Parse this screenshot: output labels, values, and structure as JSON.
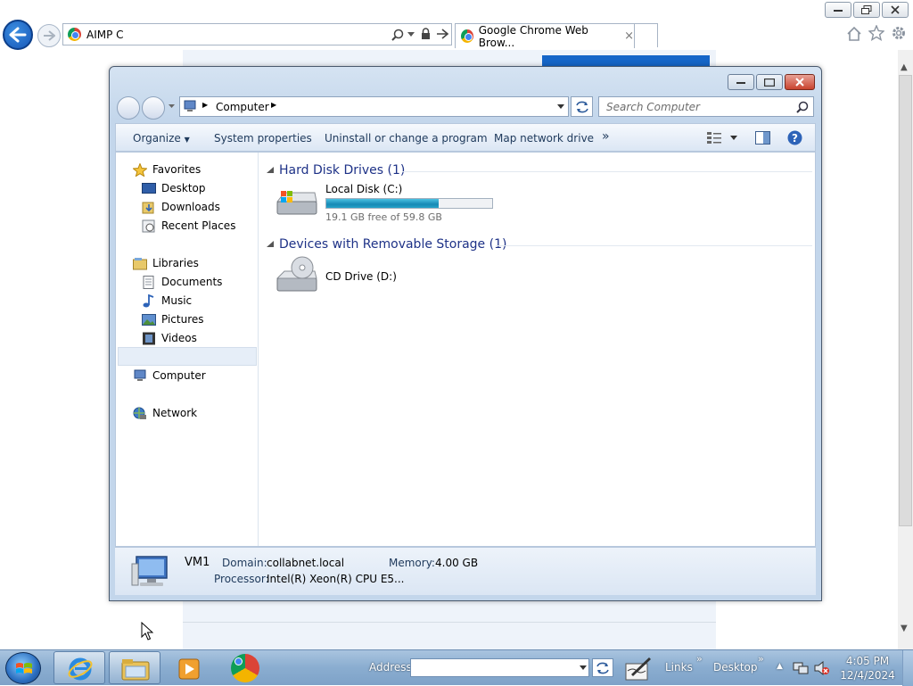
{
  "browser": {
    "address_text": "AIMP C",
    "tab_title": "Google Chrome Web Brow...",
    "tab_close_glyph": "×",
    "caption": {
      "minimize": "▭",
      "restore": "⧉",
      "close": "✕"
    },
    "icons": [
      "back-arrow-icon",
      "forward-arrow-icon",
      "search-icon",
      "lock-icon",
      "refresh-icon",
      "home-icon",
      "favorites-star-icon",
      "settings-gear-icon"
    ]
  },
  "explorer": {
    "breadcrumb": [
      "Computer"
    ],
    "search_placeholder": "Search Computer",
    "toolbar": {
      "organize": "Organize",
      "system_properties": "System properties",
      "uninstall": "Uninstall or change a program",
      "map_drive": "Map network drive",
      "more": "»"
    },
    "nav": {
      "favorites": "Favorites",
      "favorites_items": [
        "Desktop",
        "Downloads",
        "Recent Places"
      ],
      "libraries": "Libraries",
      "libraries_items": [
        "Documents",
        "Music",
        "Pictures",
        "Videos"
      ],
      "computer": "Computer",
      "network": "Network"
    },
    "groups": {
      "hdd_header": "Hard Disk Drives (1)",
      "removable_header": "Devices with Removable Storage (1)"
    },
    "drives": {
      "local_name": "Local Disk (C:)",
      "local_free_text": "19.1 GB free of 59.8 GB",
      "local_used_fraction": 0.68,
      "cd_name": "CD Drive (D:)"
    },
    "details": {
      "computer_name": "VM1",
      "domain_label": "Domain:",
      "domain_value": "collabnet.local",
      "memory_label": "Memory:",
      "memory_value": "4.00 GB",
      "processor_label": "Processor:",
      "processor_value": "Intel(R) Xeon(R) CPU E5..."
    }
  },
  "taskbar": {
    "address_label": "Address",
    "links_label": "Links",
    "desktop_label": "Desktop",
    "time": "4:05 PM",
    "date": "12/4/2024"
  },
  "colors": {
    "accent_blue": "#1565c8",
    "group_header": "#1e3287",
    "disk_bar": "#1fa0c6"
  }
}
